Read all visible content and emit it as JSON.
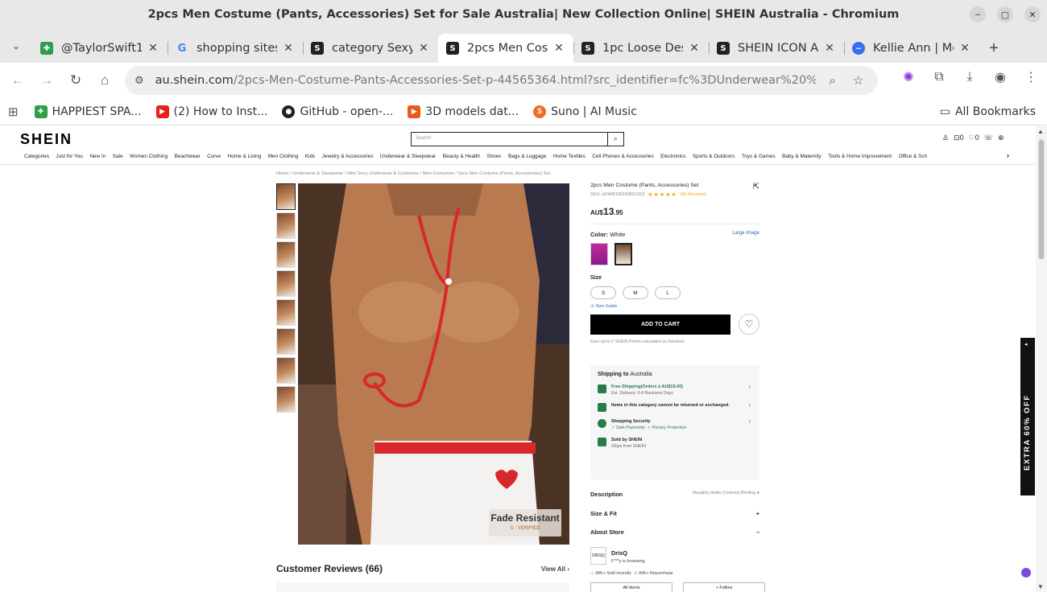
{
  "window": {
    "title": "2pcs Men Costume (Pants, Accessories) Set for Sale Australia| New Collection Online| SHEIN Australia - Chromium"
  },
  "tabs": [
    {
      "label": "@TaylorSwift1",
      "favicon": "green-star",
      "active": false
    },
    {
      "label": "shopping sites",
      "favicon": "google-g",
      "active": false
    },
    {
      "label": "category Sexy",
      "favicon": "shein-s",
      "active": false
    },
    {
      "label": "2pcs Men Cost",
      "favicon": "shein-s",
      "active": true
    },
    {
      "label": "1pc Loose Des",
      "favicon": "shein-s",
      "active": false
    },
    {
      "label": "SHEIN ICON Al",
      "favicon": "shein-s",
      "active": false
    },
    {
      "label": "Kellie Ann | Me",
      "favicon": "messenger",
      "active": false
    }
  ],
  "toolbar": {
    "url_host": "au.shein.com",
    "url_path": "/2pcs-Men-Costume-Pants-Accessories-Set-p-44565364.html?src_identifier=fc%3DUnderwear%20%26%20Sleepwe..."
  },
  "bookmarks": [
    {
      "label": "HAPPIEST SPA...",
      "color": "#2e9e4a"
    },
    {
      "label": "(2) How to Inst...",
      "color": "#e62117"
    },
    {
      "label": "GitHub - open-...",
      "color": "#222222"
    },
    {
      "label": "3D models dat...",
      "color": "#e85a1a"
    },
    {
      "label": "Suno | AI Music",
      "color": "#f06a2a"
    }
  ],
  "all_bookmarks": "All Bookmarks",
  "shein": {
    "logo": "SHEIN",
    "search_placeholder": "Search",
    "cart_count": "0",
    "wish_count": "0",
    "categories": [
      "Categories",
      "Just for You",
      "New In",
      "Sale",
      "Women Clothing",
      "Beachwear",
      "Curve",
      "Home & Living",
      "Men Clothing",
      "Kids",
      "Jewelry & Accessories",
      "Underwear & Sleepwear",
      "Beauty & Health",
      "Shoes",
      "Bags & Luggage",
      "Home Textiles",
      "Cell Phones & Accessories",
      "Electronics",
      "Sports & Outdoors",
      "Toys & Games",
      "Baby & Maternity",
      "Tools & Home Improvement",
      "Office & Sch"
    ],
    "breadcrumb": "Home / Underwear & Sleepwear / Men Sexy Underwear & Costumes / Men Costumes / 2pcs Men Costume (Pants, Accessories) Set",
    "badge_title": "Fade Resistant",
    "badge_sub": "S · VERIFIED"
  },
  "product": {
    "title": "2pcs Men Costume (Pants, Accessories) Set",
    "sku": "SKU: sl2409100160551323",
    "stars": "★★★★★",
    "reviews_link": "(66 Reviews)",
    "price_currency": "AU$",
    "price_whole": "13",
    "price_cents": ".95",
    "color_label": "Color:",
    "color_value": "White",
    "large_image": "Large Image",
    "size_label": "Size",
    "sizes": [
      "S",
      "M",
      "L"
    ],
    "size_guide": "Size Guide",
    "add_to_cart": "ADD TO CART",
    "points": "Earn up to 0 SHEIN Points calculated at checkout."
  },
  "shipping": {
    "heading": "Shipping to",
    "country": "Australia",
    "free_ship": "Free Shipping(Orders ≥ AU$19.00)",
    "delivery": "Est. Delivery: 5-9 Business Days",
    "returns": "Items in this category cannot be returned or exchanged.",
    "security": "Shopping Security",
    "safe_payments": "✓ Safe Payments",
    "privacy": "✓ Privacy Protection",
    "sold_by": "Sold by SHEIN",
    "ships_from": "Ships from SHEIN"
  },
  "accordion": {
    "description": "Description",
    "description_value": "Naughty,Halter,Contrast Binding",
    "size_fit": "Size & Fit",
    "about_store": "About Store"
  },
  "store": {
    "logo_text": "DRISQ",
    "name": "DrisQ",
    "browsing": "F***y is browsing",
    "sold": "99K+ Sold recently",
    "repurchase": "40K+ Repurchase",
    "all_items": "All Items",
    "follow": "+ Follow"
  },
  "reviews": {
    "title": "Customer Reviews (66)",
    "view_all": "View All"
  },
  "promo": {
    "text": "EXTRA 60% OFF"
  }
}
